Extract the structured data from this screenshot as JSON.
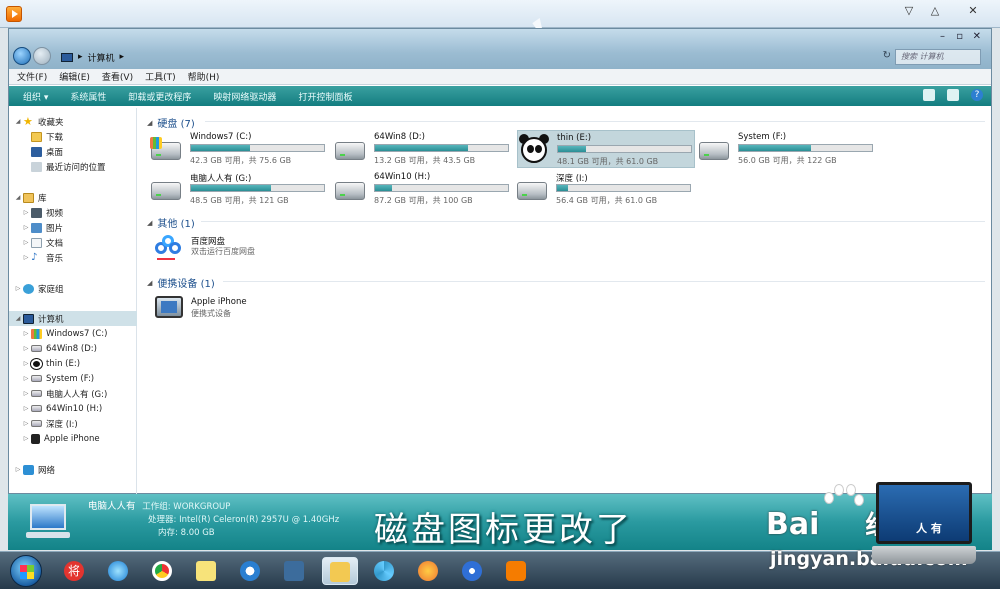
{
  "window": {
    "breadcrumb": "计算机",
    "search_placeholder": "搜索 计算机"
  },
  "menu": [
    "文件(F)",
    "编辑(E)",
    "查看(V)",
    "工具(T)",
    "帮助(H)"
  ],
  "toolbar": {
    "organize": "组织 ▾",
    "system_properties": "系统属性",
    "uninstall": "卸载或更改程序",
    "map_drive": "映射网络驱动器",
    "control_panel": "打开控制面板"
  },
  "tree": {
    "favorites": "收藏夹",
    "download": "下载",
    "desktop": "桌面",
    "recent": "最近访问的位置",
    "library": "库",
    "videos": "视频",
    "pictures": "图片",
    "documents": "文档",
    "music": "音乐",
    "homegroup": "家庭组",
    "computer": "计算机",
    "drives": [
      "Windows7 (C:)",
      "64Win8 (D:)",
      "thin (E:)",
      "System (F:)",
      "电脑人人有 (G:)",
      "64Win10 (H:)",
      "深度 (I:)",
      "Apple iPhone"
    ],
    "network": "网络"
  },
  "groups": {
    "hard_disks": "硬盘 (7)",
    "other": "其他 (1)",
    "portable": "便携设备 (1)"
  },
  "drives": [
    {
      "name": "Windows7 (C:)",
      "info": "42.3 GB 可用，共 75.6 GB",
      "used": 0.44
    },
    {
      "name": "64Win8 (D:)",
      "info": "13.2 GB 可用，共 43.5 GB",
      "used": 0.7
    },
    {
      "name": "thin (E:)",
      "info": "48.1 GB 可用，共 61.0 GB",
      "used": 0.21
    },
    {
      "name": "System (F:)",
      "info": "56.0 GB 可用，共 122 GB",
      "used": 0.54
    },
    {
      "name": "电脑人人有 (G:)",
      "info": "48.5 GB 可用，共 121 GB",
      "used": 0.6
    },
    {
      "name": "64Win10 (H:)",
      "info": "87.2 GB 可用，共 100 GB",
      "used": 0.13
    },
    {
      "name": "深度 (I:)",
      "info": "56.4 GB 可用，共 61.0 GB",
      "used": 0.08
    }
  ],
  "other_items": [
    {
      "name": "百度网盘",
      "sub": "双击运行百度网盘"
    }
  ],
  "portable_items": [
    {
      "name": "Apple iPhone",
      "sub": "便携式设备"
    }
  ],
  "details": {
    "pc_name": "电脑人人有",
    "workgroup_label": "工作组:",
    "workgroup": "WORKGROUP",
    "cpu_label": "处理器:",
    "cpu": "Intel(R) Celeron(R) 2957U @ 1.40GHz",
    "mem_label": "内存:",
    "mem": "8.00 GB"
  },
  "caption": "磁盘图标更改了",
  "watermark": {
    "logo": "Bai",
    "logo_cn": "经验",
    "url": "jingyan.baidu.com",
    "laptop_text": "人 有"
  }
}
